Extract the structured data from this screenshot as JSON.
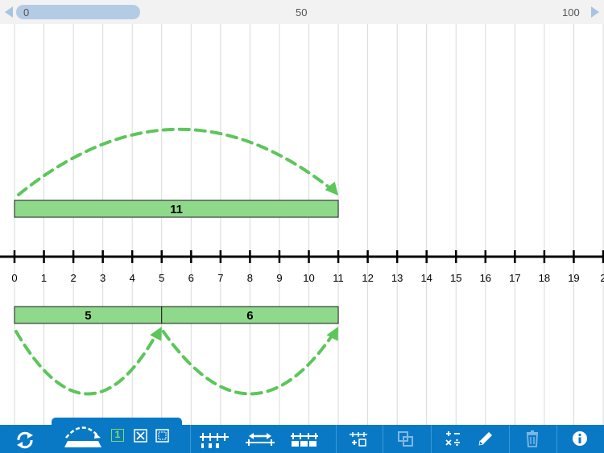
{
  "scrollbar": {
    "label_start": "0",
    "label_mid": "50",
    "label_end": "100"
  },
  "number_line": {
    "min": 0,
    "max": 20,
    "tick_labels": [
      "0",
      "1",
      "2",
      "3",
      "4",
      "5",
      "6",
      "7",
      "8",
      "9",
      "10",
      "11",
      "12",
      "13",
      "14",
      "15",
      "16",
      "17",
      "18",
      "19",
      "2"
    ]
  },
  "bars_above": [
    {
      "start": 0,
      "end": 11,
      "label": "11"
    }
  ],
  "bars_below": [
    {
      "start": 0,
      "end": 5,
      "label": "5"
    },
    {
      "start": 5,
      "end": 11,
      "label": "6"
    }
  ],
  "colors": {
    "bar_fill": "#8fd98b",
    "arc": "#5cc65a",
    "toolbar": "#0a79c5",
    "grid": "#d9d9d9",
    "axis": "#000000",
    "mode_active": "#7ddf5e"
  },
  "toolbar": {
    "mode_number_label": "1",
    "icons": [
      "refresh-icon",
      "jump-arc-icon",
      "number-mode-icon",
      "hide-mode-icon",
      "blank-mode-icon",
      "tick-labels-icon",
      "stretch-icon",
      "bar-blocks-icon",
      "add-box-icon",
      "copy-icon",
      "operations-icon",
      "pencil-icon",
      "trash-icon",
      "info-icon"
    ]
  }
}
